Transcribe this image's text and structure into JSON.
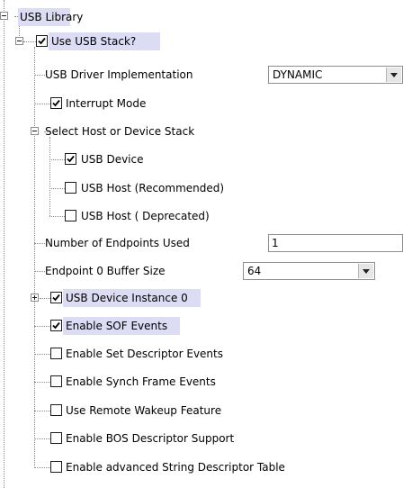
{
  "tree": {
    "usb_library": {
      "label": "USB Library"
    },
    "use_usb_stack": {
      "label": "Use USB Stack?",
      "checked": true
    },
    "driver_impl": {
      "label": "USB Driver Implementation",
      "value": "DYNAMIC"
    },
    "interrupt_mode": {
      "label": "Interrupt Mode",
      "checked": true
    },
    "select_stack": {
      "label": "Select Host or Device Stack"
    },
    "usb_device": {
      "label": "USB Device",
      "checked": true
    },
    "usb_host_rec": {
      "label": "USB Host (Recommended)",
      "checked": false
    },
    "usb_host_dep": {
      "label": "USB Host ( Deprecated)",
      "checked": false
    },
    "num_endpoints": {
      "label": "Number of Endpoints Used",
      "value": "1"
    },
    "ep0_buffer": {
      "label": "Endpoint 0 Buffer Size",
      "value": "64"
    },
    "device_instance": {
      "label": "USB Device Instance 0",
      "checked": true
    },
    "sof_events": {
      "label": "Enable SOF Events",
      "checked": true
    },
    "set_descriptor": {
      "label": "Enable Set Descriptor Events",
      "checked": false
    },
    "synch_frame": {
      "label": "Enable Synch Frame Events",
      "checked": false
    },
    "remote_wakeup": {
      "label": "Use Remote Wakeup Feature",
      "checked": false
    },
    "bos_descriptor": {
      "label": "Enable BOS Descriptor Support",
      "checked": false
    },
    "advanced_string": {
      "label": "Enable advanced String Descriptor Table",
      "checked": false
    }
  },
  "colors": {
    "highlight": "#dcdcf5",
    "tree_lines": "#8a8a8a"
  },
  "icons": {
    "expander_minus": "minus-box",
    "expander_plus": "plus-box",
    "checkmark": "check"
  }
}
